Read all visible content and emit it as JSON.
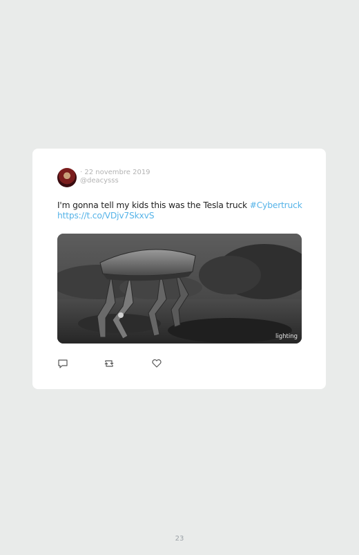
{
  "tweet": {
    "date": "· 22 novembre 2019",
    "handle": "@deacysss",
    "text_plain": "I'm gonna tell my kids this was the Tesla truck ",
    "hashtag": "#Cybertruck",
    "url": "https://t.co/VDjv7SkxvS",
    "media_caption": "lighting",
    "avatar_icon": "profile-avatar"
  },
  "actions": [
    {
      "name": "reply-icon"
    },
    {
      "name": "retweet-icon"
    },
    {
      "name": "like-icon"
    }
  ],
  "page": {
    "number": "23"
  },
  "colors": {
    "background": "#e9ebea",
    "card": "#ffffff",
    "link": "#55b3e8",
    "muted": "#b3b3b3"
  }
}
